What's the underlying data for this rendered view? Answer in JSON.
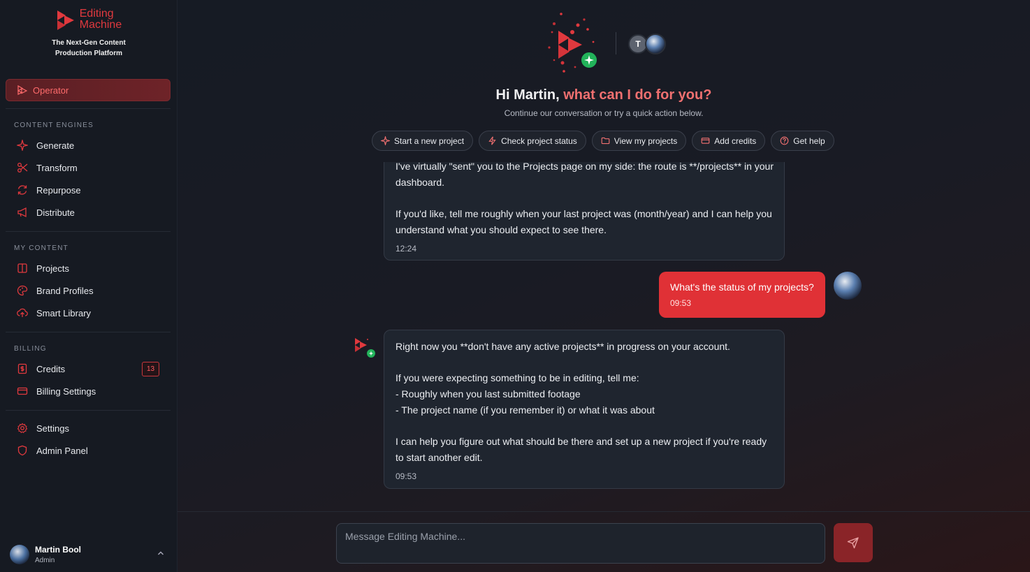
{
  "brand": {
    "name_line1": "Editing",
    "name_line2": "Machine",
    "tagline_line1": "The Next-Gen Content",
    "tagline_line2": "Production Platform"
  },
  "sidebar": {
    "operator": "Operator",
    "content_engines_label": "CONTENT ENGINES",
    "engines": [
      "Generate",
      "Transform",
      "Repurpose",
      "Distribute"
    ],
    "my_content_label": "MY CONTENT",
    "my_content": [
      "Projects",
      "Brand Profiles",
      "Smart Library"
    ],
    "billing_label": "BILLING",
    "billing": [
      "Credits",
      "Billing Settings"
    ],
    "credits_badge": "13",
    "other": [
      "Settings",
      "Admin Panel"
    ]
  },
  "user": {
    "name": "Martin Bool",
    "role": "Admin"
  },
  "header": {
    "avatar_initial": "T",
    "greeting_white": "Hi Martin, ",
    "greeting_red": "what can I do for you?",
    "subtitle": "Continue our conversation or try a quick action below."
  },
  "actions": [
    "Start a new project",
    "Check project status",
    "View my projects",
    "Add credits",
    "Get help"
  ],
  "messages": {
    "ai1_lines": [
      "I've virtually \"sent\" you to the Projects page on my side: the route is **/projects** in your",
      "dashboard.",
      "",
      "If you'd like, tell me roughly when your last project was (month/year) and I can help you",
      "understand what you should expect to see there."
    ],
    "ai1_time": "12:24",
    "user_text": "What's the status of my projects?",
    "user_time": "09:53",
    "ai2_lines": [
      "Right now you **don't have any active projects** in progress on your account.",
      "",
      "If you were expecting something to be in editing, tell me:",
      "- Roughly when you last submitted footage",
      "- The project name (if you remember it) or what it was about",
      "",
      "I can help you figure out what should be there and set up a new project if you're ready",
      "to start another edit."
    ],
    "ai2_time": "09:53"
  },
  "composer": {
    "placeholder": "Message Editing Machine..."
  },
  "colors": {
    "accent": "#e03136",
    "accent_text": "#f07070",
    "background": "#141821"
  }
}
